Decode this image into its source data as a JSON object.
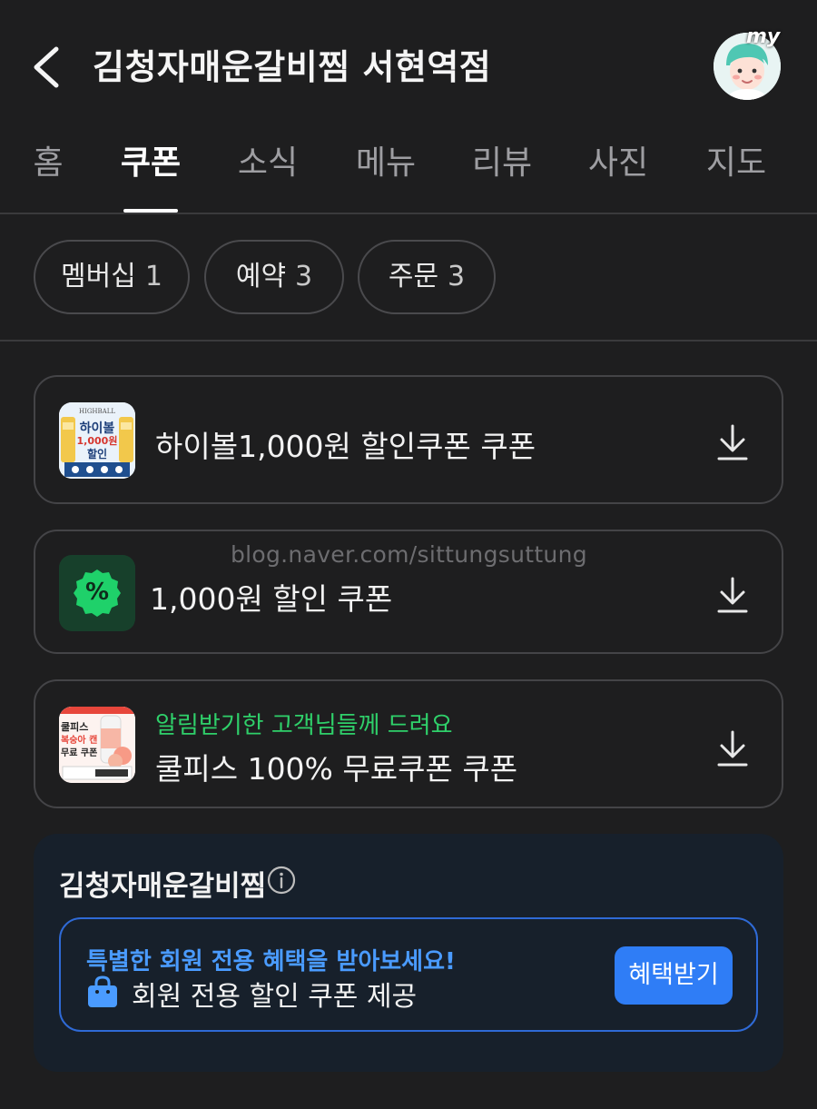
{
  "header": {
    "title": "김청자매운갈비찜 서현역점",
    "avatar_badge": "my"
  },
  "tabs": [
    {
      "label": "홈",
      "active": false
    },
    {
      "label": "쿠폰",
      "active": true
    },
    {
      "label": "소식",
      "active": false
    },
    {
      "label": "메뉴",
      "active": false
    },
    {
      "label": "리뷰",
      "active": false
    },
    {
      "label": "사진",
      "active": false
    },
    {
      "label": "지도",
      "active": false
    }
  ],
  "chips": [
    {
      "label": "멤버십",
      "count": "1"
    },
    {
      "label": "예약",
      "count": "3"
    },
    {
      "label": "주문",
      "count": "3"
    }
  ],
  "coupons": [
    {
      "title": "하이볼1,000원 할인쿠폰 쿠폰",
      "thumb": {
        "top_text": "HIGHBALL",
        "main": "하이볼",
        "amount": "1,000원",
        "label": "할인"
      }
    },
    {
      "title": "1,000원 할인 쿠폰",
      "thumb": {
        "symbol": "%"
      }
    },
    {
      "subtitle": "알림받기한 고객님들께 드려요",
      "title": "쿨피스 100% 무료쿠폰 쿠폰",
      "thumb": {
        "line1": "쿨피스",
        "line2": "복숭아 캔",
        "line3": "무료 쿠폰"
      }
    }
  ],
  "watermark": "blog.naver.com/sittungsuttung",
  "membership": {
    "title": "김청자매운갈비찜",
    "promo": "특별한 회원 전용 혜택을 받아보세요!",
    "description": "회원 전용 할인 쿠폰 제공",
    "button_label": "혜택받기"
  },
  "colors": {
    "background": "#1e1e1f",
    "accent_green": "#2fd06a",
    "accent_blue": "#2f7df6",
    "promo_blue": "#4a9bff",
    "panel_bg": "#17202b"
  },
  "icons": {
    "back": "chevron-left-icon",
    "download": "download-icon",
    "info": "info-icon",
    "bag": "shopping-bag-icon"
  }
}
